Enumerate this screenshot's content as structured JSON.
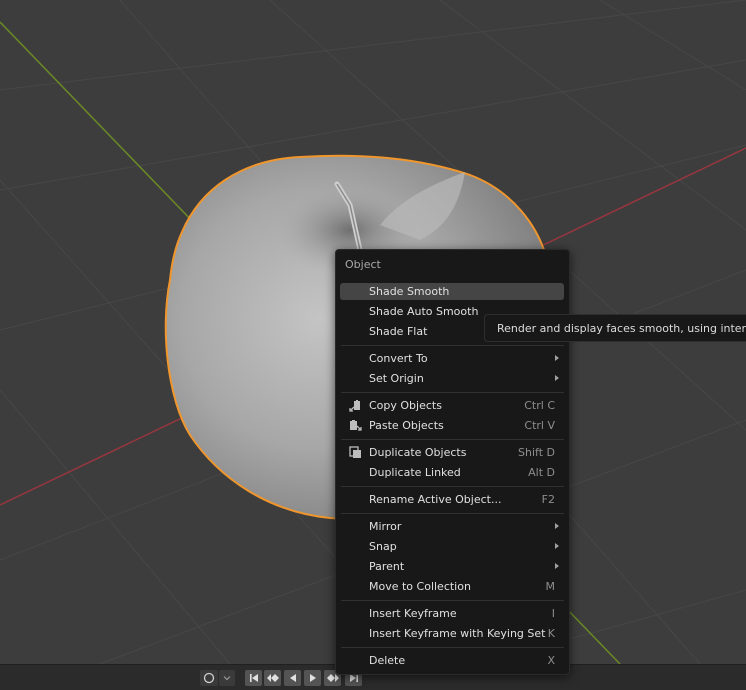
{
  "context_menu": {
    "title": "Object",
    "items": [
      {
        "label": "Shade Smooth"
      },
      {
        "label": "Shade Auto Smooth"
      },
      {
        "label": "Shade Flat"
      },
      {
        "label": "Convert To"
      },
      {
        "label": "Set Origin"
      },
      {
        "label": "Copy Objects",
        "shortcut": "Ctrl C"
      },
      {
        "label": "Paste Objects",
        "shortcut": "Ctrl V"
      },
      {
        "label": "Duplicate Objects",
        "shortcut": "Shift D"
      },
      {
        "label": "Duplicate Linked",
        "shortcut": "Alt D"
      },
      {
        "label": "Rename Active Object...",
        "shortcut": "F2"
      },
      {
        "label": "Mirror"
      },
      {
        "label": "Snap"
      },
      {
        "label": "Parent"
      },
      {
        "label": "Move to Collection",
        "shortcut": "M"
      },
      {
        "label": "Insert Keyframe",
        "shortcut": "I"
      },
      {
        "label": "Insert Keyframe with Keying Set",
        "shortcut": "K"
      },
      {
        "label": "Delete",
        "shortcut": "X"
      }
    ]
  },
  "tooltip": {
    "text": "Render and display faces smooth, using interpo"
  },
  "colors": {
    "viewport_bg": "#3d3d3d",
    "grid_line": "#484848",
    "x_axis": "#96363e",
    "y_axis": "#6b8a26",
    "selection_outline": "#f0962c",
    "mesh": "#a8a8a8"
  },
  "timeline": {
    "buttons": [
      "record-icon",
      "dropdown-icon",
      "jump-start-icon",
      "prev-keyframe-icon",
      "play-reverse-icon",
      "play-icon",
      "next-keyframe-icon",
      "jump-end-icon"
    ]
  }
}
